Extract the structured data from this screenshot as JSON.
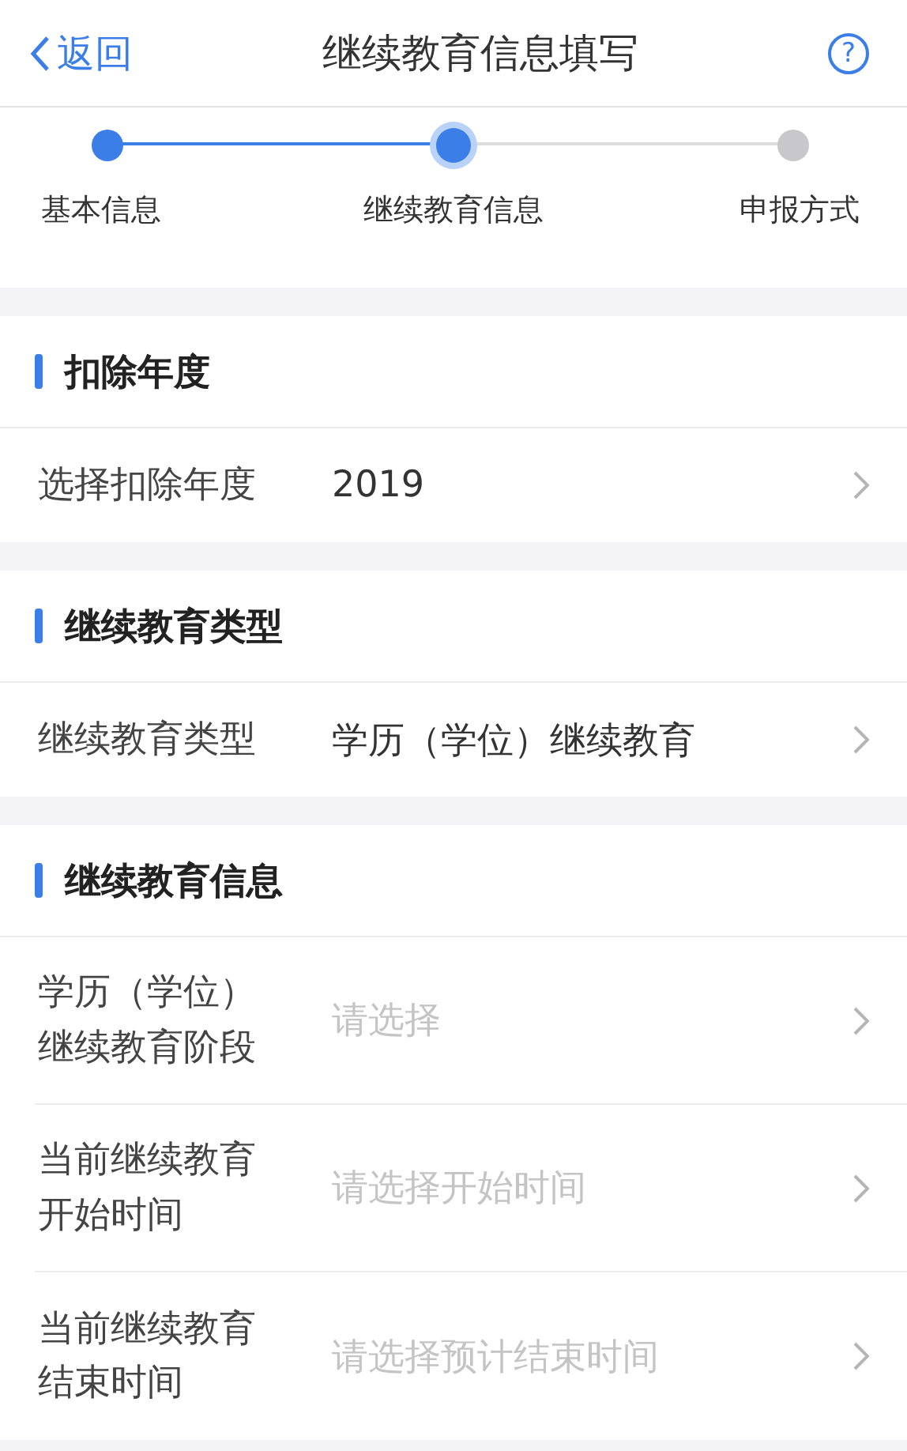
{
  "nav": {
    "back": "返回",
    "title": "继续教育信息填写",
    "help": "?"
  },
  "steps": [
    {
      "label": "基本信息",
      "done": true,
      "selected": false
    },
    {
      "label": "继续教育信息",
      "done": false,
      "selected": true
    },
    {
      "label": "申报方式",
      "done": false,
      "selected": false
    }
  ],
  "sections": [
    {
      "title": "扣除年度",
      "rows": [
        {
          "label": "选择扣除年度",
          "value": "2019"
        }
      ]
    },
    {
      "title": "继续教育类型",
      "rows": [
        {
          "label": "继续教育类型",
          "value": "学历（学位）继续教育"
        }
      ]
    },
    {
      "title": "继续教育信息",
      "rows": [
        {
          "label": "学历（学位）继续教育阶段",
          "placeholder": "请选择"
        },
        {
          "label": "当前继续教育开始时间",
          "placeholder": "请选择开始时间"
        },
        {
          "label": "当前继续教育结束时间",
          "placeholder": "请选择预计结束时间"
        }
      ]
    }
  ]
}
